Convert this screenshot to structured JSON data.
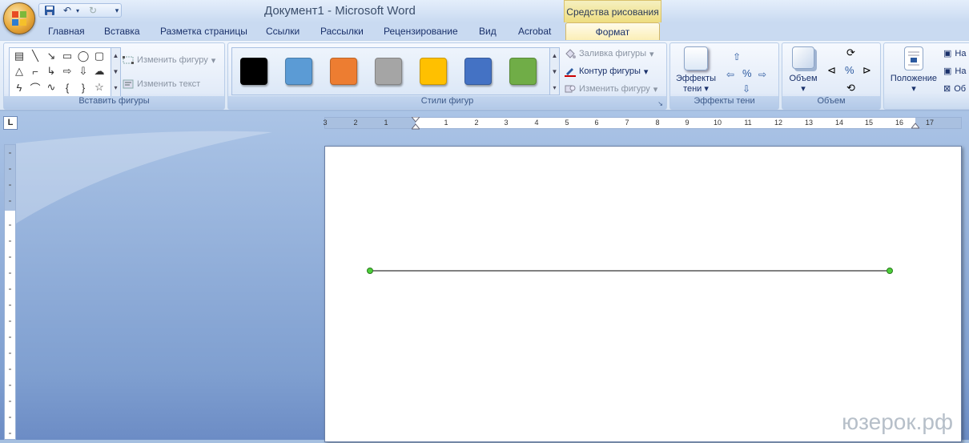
{
  "window": {
    "title": "Документ1 - Microsoft Word",
    "context_tool": "Средства рисования"
  },
  "tabs": [
    "Главная",
    "Вставка",
    "Разметка страницы",
    "Ссылки",
    "Рассылки",
    "Рецензирование",
    "Вид",
    "Acrobat"
  ],
  "active_tab": "Формат",
  "groups": {
    "insert_shapes": {
      "label": "Вставить фигуры",
      "edit_shape": "Изменить фигуру",
      "edit_text": "Изменить текст"
    },
    "shape_styles": {
      "label": "Стили фигур",
      "swatches": [
        "#000000",
        "#5b9bd5",
        "#ed7d31",
        "#a5a5a5",
        "#ffc000",
        "#4472c4",
        "#70ad47"
      ],
      "fill": "Заливка фигуры",
      "outline": "Контур фигуры",
      "change": "Изменить фигуру"
    },
    "shadow": {
      "label": "Эффекты тени",
      "button1": "Эффекты",
      "button2": "тени"
    },
    "volume": {
      "label": "Объем",
      "button": "Объем"
    },
    "arrange": {
      "button": "Положение",
      "item1": "На",
      "item2": "На",
      "item3": "Об"
    }
  },
  "ruler": {
    "corner": "L",
    "labels": [
      "3",
      "2",
      "1",
      "1",
      "2",
      "3",
      "4",
      "5",
      "6",
      "7",
      "8",
      "9",
      "10",
      "11",
      "12",
      "13",
      "14",
      "15",
      "16",
      "17"
    ]
  },
  "watermark": "юзерок.рф"
}
